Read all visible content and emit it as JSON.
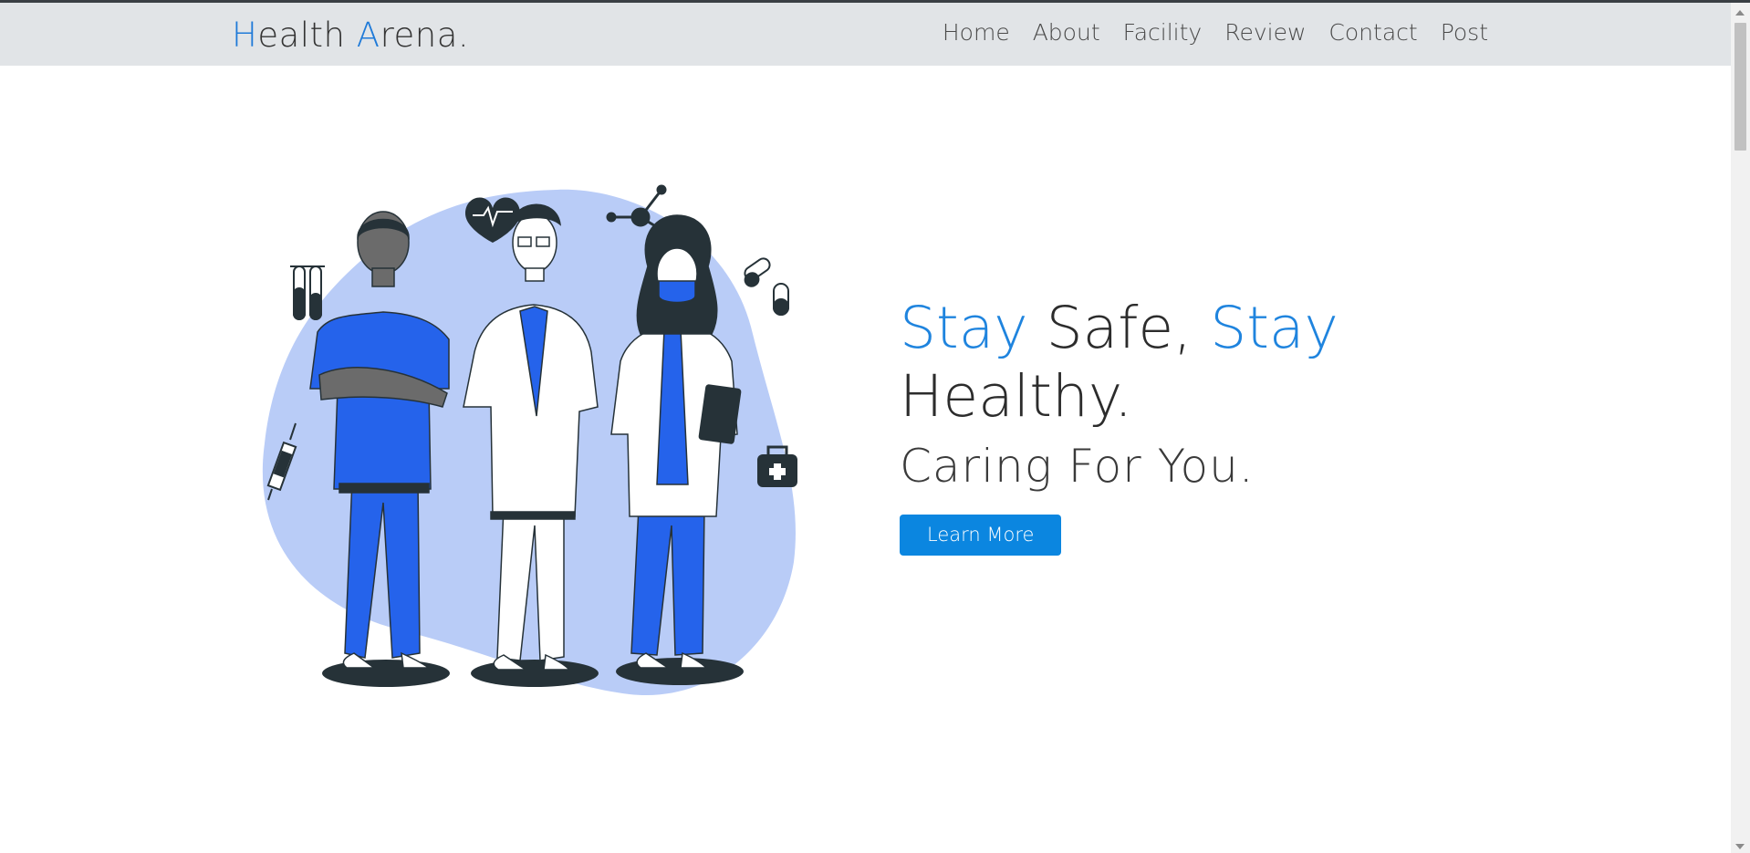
{
  "brand": {
    "first_initial": "H",
    "first_rest": "ealth ",
    "second_initial": "A",
    "second_rest": "rena."
  },
  "nav": {
    "items": [
      {
        "label": "Home"
      },
      {
        "label": "About"
      },
      {
        "label": "Facility"
      },
      {
        "label": "Review"
      },
      {
        "label": "Contact"
      },
      {
        "label": "Post"
      }
    ]
  },
  "hero": {
    "word_stay1": "Stay",
    "word_safe": " Safe, ",
    "word_stay2": "Stay",
    "word_healthy": "Healthy.",
    "subheading": "Caring For You.",
    "cta_label": "Learn More"
  },
  "colors": {
    "accent": "#1f84de",
    "button": "#0b86e0",
    "header_bg": "#e1e4e7",
    "illustration_blue": "#2563eb",
    "blob": "#b9ccf7"
  }
}
